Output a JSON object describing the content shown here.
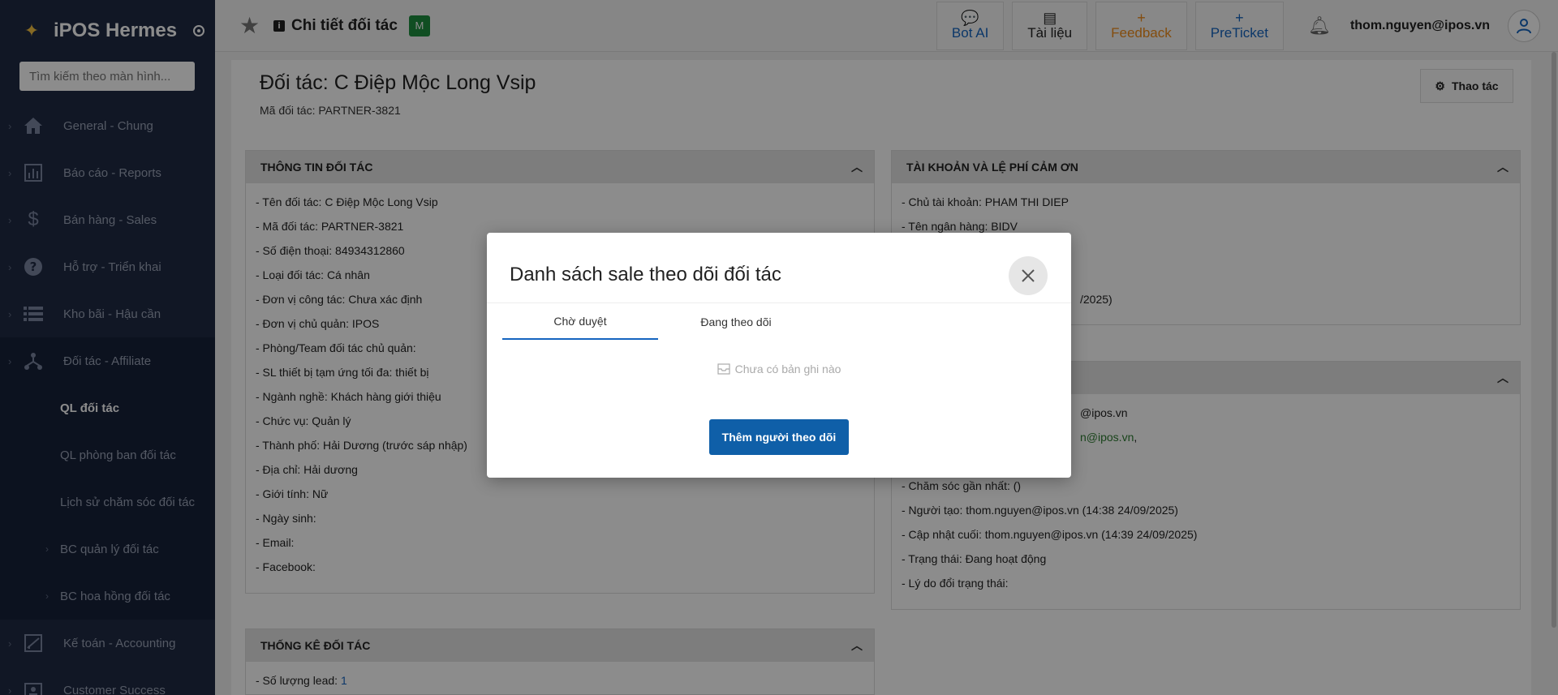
{
  "sidebar": {
    "brand": "iPOS Hermes",
    "search_placeholder": "Tìm kiếm theo màn hình...",
    "items": [
      {
        "label": "General - Chung",
        "icon": "home-icon"
      },
      {
        "label": "Báo cáo - Reports",
        "icon": "chart-icon"
      },
      {
        "label": "Bán hàng - Sales",
        "icon": "dollar-icon"
      },
      {
        "label": "Hỗ trợ - Triển khai",
        "icon": "help-icon"
      },
      {
        "label": "Kho bãi - Hậu cần",
        "icon": "list-icon"
      },
      {
        "label": "Đối tác - Affiliate",
        "icon": "network-icon"
      }
    ],
    "sub_items": [
      {
        "label": "QL đối tác"
      },
      {
        "label": "QL phòng ban đối tác"
      },
      {
        "label": "Lịch sử chăm sóc đối tác"
      },
      {
        "label": "BC quản lý đối tác"
      },
      {
        "label": "BC hoa hồng đối tác"
      }
    ],
    "bottom_items": [
      {
        "label": "Kế toán - Accounting",
        "icon": "edit-chart-icon"
      },
      {
        "label": "Customer Success",
        "icon": "badge-icon"
      }
    ]
  },
  "topbar": {
    "title": "Chi tiết đối tác",
    "badge": "M",
    "buttons": {
      "bot_ai": "Bot AI",
      "tai_lieu": "Tài liệu",
      "feedback": "Feedback",
      "feedback_plus": "+",
      "preticket": "PreTicket",
      "preticket_plus": "+"
    },
    "user_email": "thom.nguyen@ipos.vn"
  },
  "page": {
    "title": "Đối tác: C Điệp Mộc Long Vsip",
    "subtitle": "Mã đối tác: PARTNER-3821",
    "action_button": "Thao tác"
  },
  "panels": {
    "info": {
      "title": "THÔNG TIN ĐỐI TÁC",
      "lines": [
        "- Tên đối tác: C Điệp Mộc Long Vsip",
        "- Mã đối tác: PARTNER-3821",
        "- Số điện thoại: 84934312860",
        "- Loại đối tác: Cá nhân",
        "- Đơn vị công tác: Chưa xác định",
        "- Đơn vị chủ quản: IPOS",
        "- Phòng/Team đối tác chủ quản:",
        "- SL thiết bị tạm ứng tối đa: thiết bị",
        "- Ngành nghề: Khách hàng giới thiệu",
        "- Chức vụ: Quản lý",
        "- Thành phố: Hải Dương (trước sáp nhập)",
        "- Địa chỉ: Hải dương",
        "- Giới tính: Nữ",
        "- Ngày sinh:",
        "- Email:",
        "- Facebook:"
      ]
    },
    "account": {
      "title": "TÀI KHOẢN VÀ LỆ PHÍ CẢM ƠN",
      "lines": [
        "- Chủ tài khoản: PHAM THI DIEP",
        "- Tên ngân hàng: BIDV"
      ],
      "partial_line": "/2025)"
    },
    "care": {
      "partial_1": "@ipos.vn",
      "partial_2": "n@ipos.vn",
      "partial_2_suffix": ",",
      "lines": [
        "- Chăm sóc gần nhất: ()",
        "- Người tạo: thom.nguyen@ipos.vn (14:38 24/09/2025)",
        "- Cập nhật cuối: thom.nguyen@ipos.vn (14:39 24/09/2025)",
        "- Trạng thái: Đang hoạt động",
        "- Lý do đổi trạng thái:"
      ]
    },
    "stats": {
      "title": "THỐNG KÊ ĐỐI TÁC",
      "lead_label": "- Số lượng lead: ",
      "lead_value": "1"
    }
  },
  "modal": {
    "title": "Danh sách sale theo dõi đối tác",
    "tabs": [
      "Chờ duyệt",
      "Đang theo dõi"
    ],
    "empty_text": "Chưa có bản ghi nào",
    "add_button": "Thêm người theo dõi"
  }
}
